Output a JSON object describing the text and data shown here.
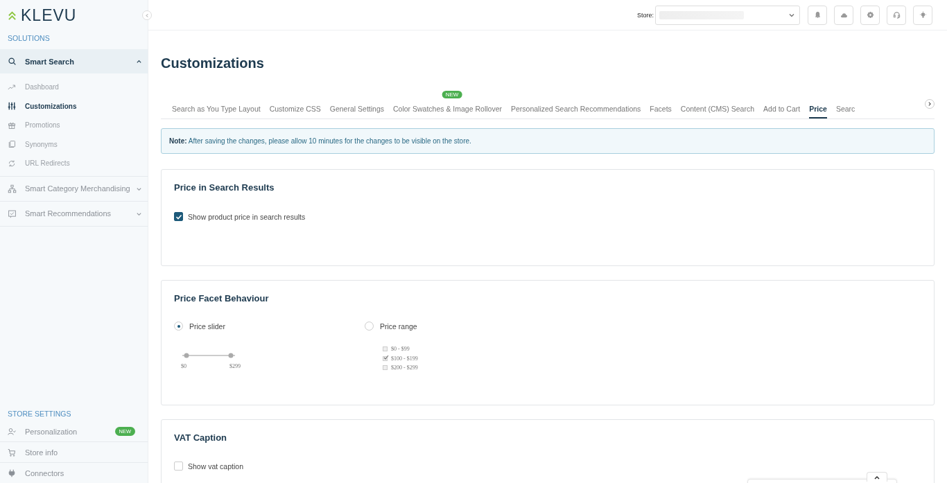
{
  "logo": {
    "text": "KLEVU"
  },
  "sidebar": {
    "solutions_heading": "SOLUTIONS",
    "groups": [
      {
        "label": "Smart Search",
        "expanded": true,
        "children": [
          {
            "label": "Dashboard",
            "selected": false
          },
          {
            "label": "Customizations",
            "selected": true
          },
          {
            "label": "Promotions",
            "selected": false
          },
          {
            "label": "Synonyms",
            "selected": false
          },
          {
            "label": "URL Redirects",
            "selected": false
          }
        ]
      },
      {
        "label": "Smart Category Merchandising",
        "expanded": false
      },
      {
        "label": "Smart Recommendations",
        "expanded": false
      }
    ],
    "store_settings_heading": "STORE SETTINGS",
    "store_settings": [
      {
        "label": "Personalization",
        "badge": "NEW"
      },
      {
        "label": "Store info"
      },
      {
        "label": "Connectors"
      }
    ]
  },
  "topbar": {
    "store_label": "Store:"
  },
  "page_title": "Customizations",
  "tabs": [
    {
      "label": "Search as You Type Layout",
      "selected": false
    },
    {
      "label": "Customize CSS",
      "selected": false
    },
    {
      "label": "General Settings",
      "selected": false
    },
    {
      "label": "Color Swatches & Image Rollover",
      "selected": false,
      "badge": "NEW"
    },
    {
      "label": "Personalized Search Recommendations",
      "selected": false
    },
    {
      "label": "Facets",
      "selected": false
    },
    {
      "label": "Content (CMS) Search",
      "selected": false
    },
    {
      "label": "Add to Cart",
      "selected": false
    },
    {
      "label": "Price",
      "selected": true
    },
    {
      "label": "Searc",
      "selected": false
    }
  ],
  "note": "**Note:** After saving the changes, please allow 10 minutes for the changes to be visible on the store.",
  "cards": [
    {
      "title": "Price in Search Results",
      "kind": "checkbox",
      "options": [
        {
          "label": "Show product price in search results",
          "checked": true
        }
      ]
    },
    {
      "title": "Price Facet Behaviour",
      "kind": "radio",
      "options": [
        {
          "label": "Price slider",
          "selected": true,
          "preview": {
            "kind": "slider",
            "labels": [
              "$0",
              "$299"
            ]
          }
        },
        {
          "label": "Price range",
          "selected": false,
          "preview": {
            "kind": "ranges",
            "items": [
              {
                "label": "$0 - $99",
                "checked": false
              },
              {
                "label": "$100 - $199",
                "checked": true
              },
              {
                "label": "$200 - $299",
                "checked": false
              }
            ]
          }
        }
      ]
    },
    {
      "title": "VAT Caption",
      "kind": "checkbox",
      "options": [
        {
          "label": "Show vat caption",
          "checked": false
        }
      ]
    }
  ]
}
